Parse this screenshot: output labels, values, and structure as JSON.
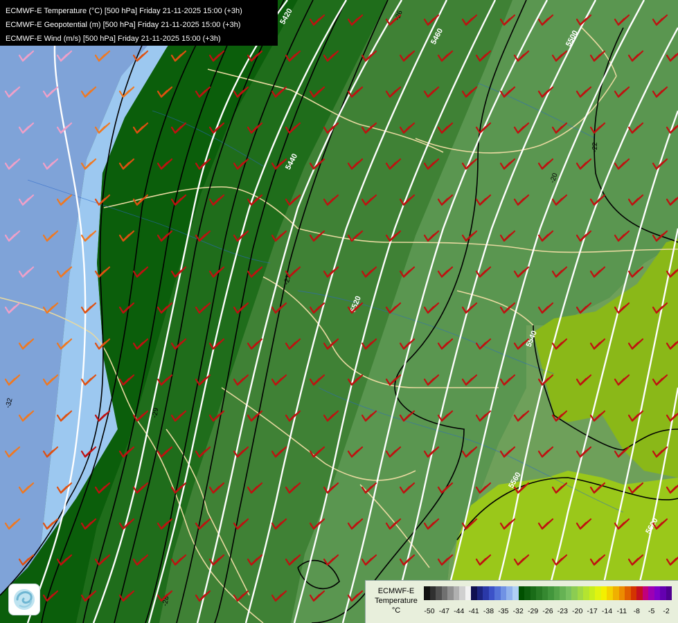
{
  "titles": [
    "ECMWF-E Temperature (°C) [500 hPa] Friday 21-11-2025 15:00 (+3h)",
    "ECMWF-E Geopotential (m) [500 hPa] Friday 21-11-2025 15:00 (+3h)",
    "ECMWF-E Wind (m/s) [500 hPa] Friday 21-11-2025 15:00 (+3h)"
  ],
  "geopotential_labels": [
    "5420",
    "5440",
    "5460",
    "5500",
    "5520",
    "5540",
    "5560",
    "5620"
  ],
  "temperature_labels": [
    "-32",
    "-29",
    "-28",
    "-26",
    "-22",
    "-21",
    "-20"
  ],
  "legend": {
    "title_line1": "ECMWF-E",
    "title_line2": "Temperature",
    "unit": "°C",
    "colors": [
      "#101010",
      "#303030",
      "#505050",
      "#707070",
      "#909090",
      "#b0b0b0",
      "#d0d0d0",
      "#f2f2f2",
      "#101050",
      "#1c2480",
      "#2a38a8",
      "#3c52c8",
      "#5472d8",
      "#7092e4",
      "#90b2ec",
      "#b0d0f4",
      "#005000",
      "#0d5e0d",
      "#1a6c18",
      "#287a24",
      "#358830",
      "#42963c",
      "#54a448",
      "#66b254",
      "#78c060",
      "#8ccc52",
      "#a0d844",
      "#b4e430",
      "#c8ee1c",
      "#e0f410",
      "#f4f000",
      "#f4d200",
      "#f0b000",
      "#ec8c00",
      "#e06000",
      "#d43400",
      "#c41020",
      "#c0007c",
      "#9c00b4",
      "#8000c8",
      "#6400b0",
      "#500090"
    ],
    "ticks": [
      "-50",
      "-47",
      "-44",
      "-41",
      "-38",
      "-35",
      "-32",
      "-29",
      "-26",
      "-23",
      "-20",
      "-17",
      "-14",
      "-11",
      "-8",
      "-5",
      "-2"
    ]
  }
}
